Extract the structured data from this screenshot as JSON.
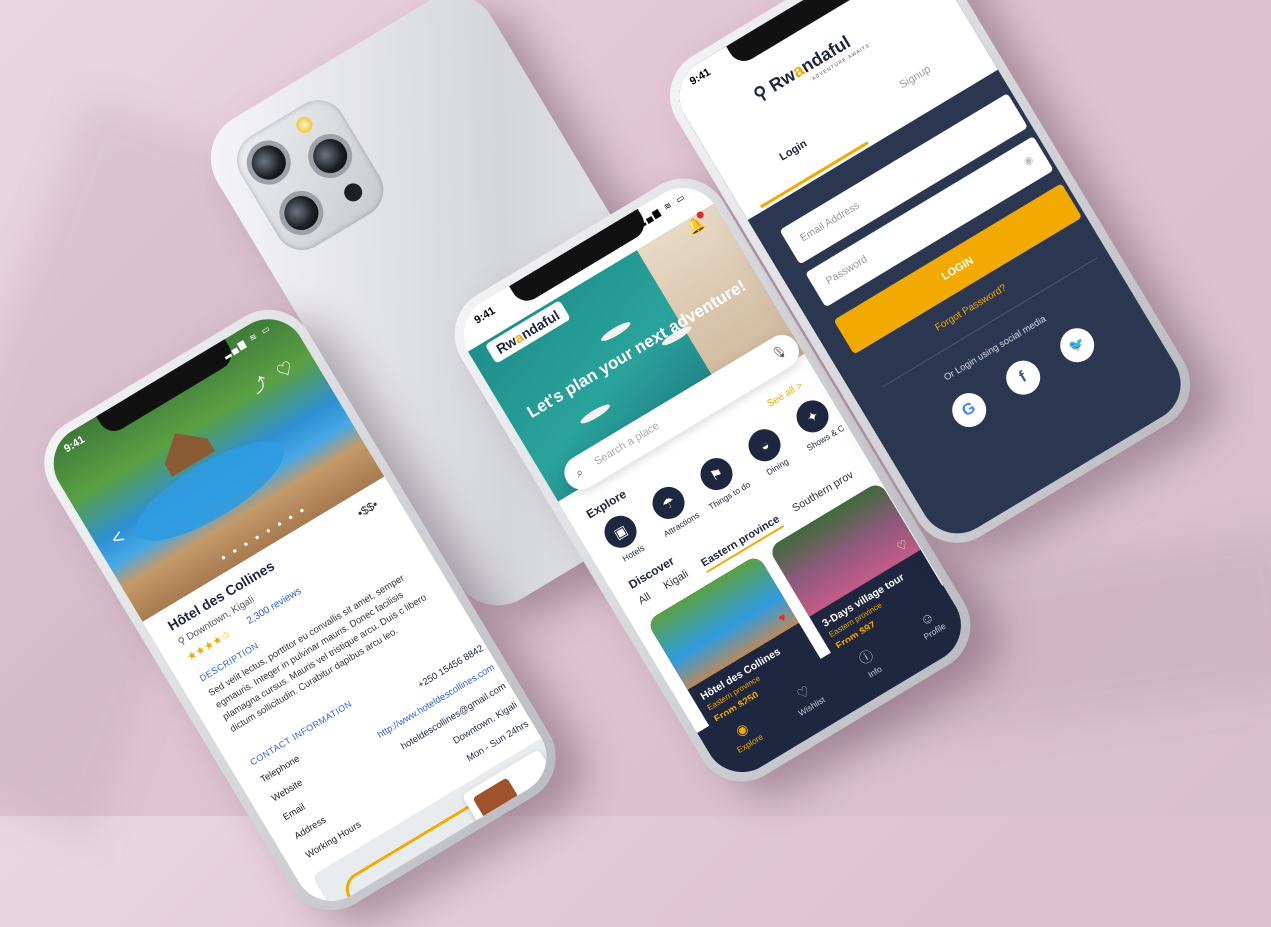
{
  "status": {
    "time": "9:41",
    "icons": "▂▄▆ ≋ ▭"
  },
  "detail": {
    "title": "Hôtel des Collines",
    "location": "Downtown, Kigali",
    "stars": "★★★★☆",
    "reviews": "2,300 reviews",
    "price_level": "•$$•",
    "dots": "● ● ● ● ● ● ● ●",
    "back": "<",
    "share_icon": "⤴",
    "heart_icon": "♡",
    "description_heading": "DESCRIPTION",
    "description": "Sed velit lectus, porttitor eu convallis sit amet, semper egmauris. Integer in pulvinar mauris. Donec facilisis plamagna cursus. Mauris vel tristique arcu. Duis c libero dictum sollicitudin. Curabitur dapibus arcu leo.",
    "contact_heading": "CONTACT INFORMATION",
    "contact": [
      {
        "label": "Telephone",
        "value": "+250 15456 8842"
      },
      {
        "label": "Website",
        "value": "http://www.hoteldescollines.com"
      },
      {
        "label": "Email",
        "value": "hoteldescollines@gmail.com"
      },
      {
        "label": "Address",
        "value": "Downtown, Kigali"
      },
      {
        "label": "Working Hours",
        "value": "Mon - Sun  24hrs"
      }
    ]
  },
  "explore": {
    "logo_prefix": "Rw",
    "logo_o": "a",
    "logo_suffix": "ndaful",
    "tagline": "Let's plan your next adventure!",
    "search_placeholder": "Search a place",
    "explore_heading": "Explore",
    "see_all": "See all >",
    "categories": [
      {
        "label": "Hotels",
        "icon": "▣"
      },
      {
        "label": "Attractions",
        "icon": "☂"
      },
      {
        "label": "Things to do",
        "icon": "⚑"
      },
      {
        "label": "Dining",
        "icon": "◒"
      },
      {
        "label": "Shows & C",
        "icon": "✦"
      }
    ],
    "discover_heading": "Discover",
    "tabs": [
      "All",
      "Kigali",
      "Eastern province",
      "Southern prov"
    ],
    "cards": [
      {
        "title": "Hôtel des Collines",
        "region": "Eastern province",
        "price": "From $250"
      },
      {
        "title": "3-Days village tour",
        "region": "Eastern province",
        "price": "From $97"
      }
    ],
    "nav": [
      {
        "label": "Explore",
        "icon": "◉"
      },
      {
        "label": "Wishlist",
        "icon": "♡"
      },
      {
        "label": "Info",
        "icon": "ⓘ"
      },
      {
        "label": "Profile",
        "icon": "☺"
      }
    ]
  },
  "login": {
    "logo_prefix": "Rw",
    "logo_o": "a",
    "logo_suffix": "ndaful",
    "logo_sub": "ADVENTURE AWAITS",
    "tab_login": "Login",
    "tab_signup": "Signup",
    "email_placeholder": "Email Address",
    "password_placeholder": "Password",
    "login_button": "LOGIN",
    "forgot": "Forgot Password?",
    "social_text": "Or Login using social media",
    "social": {
      "google": "G",
      "facebook": "f",
      "twitter": "🐦"
    }
  },
  "colors": {
    "navy": "#1e2640",
    "accent": "#f2a900",
    "link": "#2c5fcf"
  }
}
